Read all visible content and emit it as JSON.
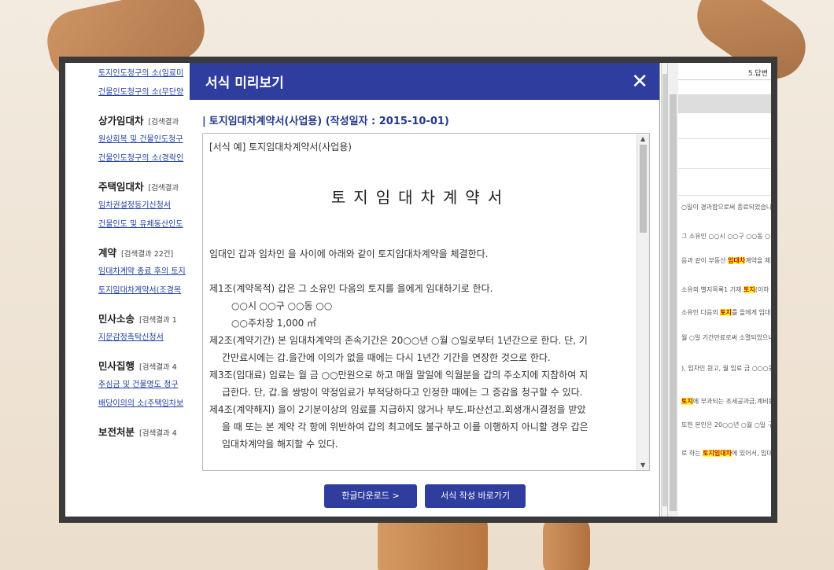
{
  "sidebar": {
    "items": [
      {
        "type": "link",
        "label": "토지인도청구의 소(임료미"
      },
      {
        "type": "link",
        "label": "건물인도청구의 소(무단양"
      },
      {
        "type": "head",
        "label": "상가임대차",
        "count": "[검색결과"
      },
      {
        "type": "link",
        "label": "원상회복 및 건물인도청구"
      },
      {
        "type": "link",
        "label": "건물인도청구의 소(경락인"
      },
      {
        "type": "head",
        "label": "주택임대차",
        "count": "[검색결과"
      },
      {
        "type": "link",
        "label": "임차권설정등기신청서"
      },
      {
        "type": "link",
        "label": "건물인도 및 유체동산인도"
      },
      {
        "type": "head",
        "label": "계약",
        "count": "[검색결과 22건]"
      },
      {
        "type": "link",
        "label": "임대차계약 종료 후의 토지"
      },
      {
        "type": "link",
        "label": "토지임대차계약서(조경목"
      },
      {
        "type": "head",
        "label": "민사소송",
        "count": "[검색결과 1"
      },
      {
        "type": "link",
        "label": "지문감정촉탁신청서"
      },
      {
        "type": "head",
        "label": "민사집행",
        "count": "[검색결과 4"
      },
      {
        "type": "link",
        "label": "추심금 및 건물명도 청구"
      },
      {
        "type": "link",
        "label": "배당이의의 소(주택임차보"
      },
      {
        "type": "head",
        "label": "보전처분",
        "count": "[검색결과 4"
      }
    ]
  },
  "right": {
    "tab": "5.답변",
    "lines": [
      {
        "pre": "",
        "hl": "",
        "post": "○일이 경과함으로써 종료되었습니"
      },
      {
        "pre": "그 소유인 ○○시 ○○구 ○○동 ○",
        "hl": "",
        "post": ""
      },
      {
        "pre": "음과 같이 부동산 ",
        "hl": "임대차",
        "post": "계약을 체결"
      },
      {
        "pre": "소유의 별지목록1 기재 ",
        "hl": "토지",
        "post": "(이하 '이"
      },
      {
        "pre": "소유인 다음의 ",
        "hl": "토지",
        "post": "를 을에게 임대"
      },
      {
        "pre": "월 ○일 기간만료로써 소멸되었으니",
        "hl": "",
        "post": ""
      },
      {
        "pre": "), 임차인 원고, 월 임료 금 ○○○원",
        "hl": "",
        "post": ""
      },
      {
        "pre": "",
        "hl": "토지",
        "post": "에 부과되는 조세공과금,계비용"
      },
      {
        "pre": "또한 본인은 20○○년 ○월 ○일 구",
        "hl": "",
        "post": ""
      },
      {
        "pre": "로 하는 ",
        "hl": "토지임대차",
        "post": "에 있어서, 임대차"
      }
    ]
  },
  "modal": {
    "title": "서식 미리보기",
    "doc_heading": "토지임대차계약서(사업용) (작성일자 : 2015-10-01)",
    "sample_label": "[서식 예] 토지임대차계약서(사업용)",
    "doc_title": "토지임대차계약서",
    "body": [
      "임대인 갑과 임차인 을 사이에 아래와 같이 토지임대차계약을 체결한다.",
      "제1조(계약목적) 갑은 그 소유인 다음의 토지를 을에게 임대하기로 한다.",
      "○○시 ○○구 ○○동 ○○",
      "○○주차장 1,000 ㎡",
      "제2조(계약기간) 본 임대차계약의 존속기간은 20○○년 ○월 ○일로부터 1년간으로 한다. 단, 기",
      "간만료시에는 갑.을간에 이의가 없을 때에는 다시 1년간 기간을 연장한 것으로 한다.",
      "제3조(임대료) 임료는 월 금 ○○만원으로 하고 매월 말일에 익월분을 갑의 주소지에 지참하여 지",
      "급한다. 단, 갑.을 쌍방이 약정임료가 부적당하다고 인정한 때에는 그 증감을 청구할 수 있다.",
      "제4조(계약해지) 을이 2기분이상의 임료를 지급하지 않거나 부도.파산선고.회생개시결정을 받았",
      "을 때 또는 본 계약 각 항에 위반하여 갑의 최고에도 불구하고 이를 이행하지 아니할 경우 갑은",
      "임대차계약을 해지할 수 있다."
    ],
    "buttons": {
      "download": "한글다운로드 >",
      "write": "서식 작성 바로가기 >"
    }
  },
  "icons": {
    "close": "✕",
    "e_badge": "Ⓔ"
  }
}
